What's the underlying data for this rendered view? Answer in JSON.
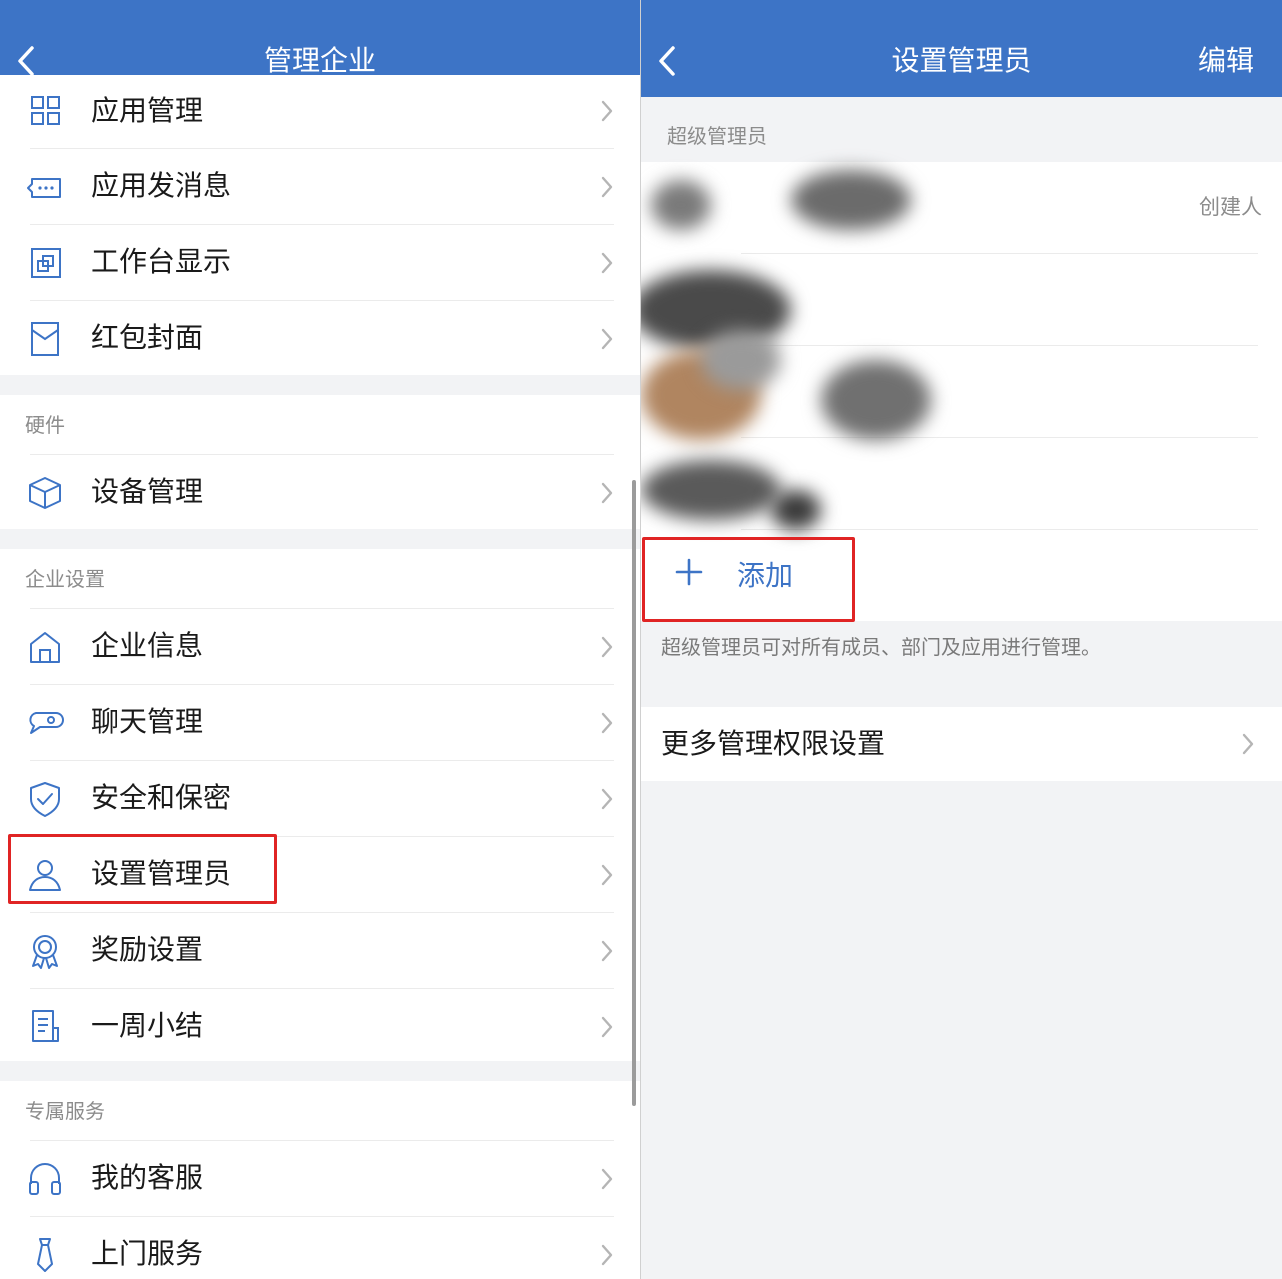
{
  "left": {
    "title": "管理企业",
    "rows_top": [
      {
        "label": "应用管理",
        "icon": "grid-icon"
      },
      {
        "label": "应用发消息",
        "icon": "message-bubble-icon"
      },
      {
        "label": "工作台显示",
        "icon": "workbench-icon"
      },
      {
        "label": "红包封面",
        "icon": "red-envelope-icon"
      }
    ],
    "hardware_header": "硬件",
    "hardware_rows": [
      {
        "label": "设备管理",
        "icon": "cube-icon"
      }
    ],
    "company_header": "企业设置",
    "company_rows": [
      {
        "label": "企业信息",
        "icon": "house-icon"
      },
      {
        "label": "聊天管理",
        "icon": "chat-icon"
      },
      {
        "label": "安全和保密",
        "icon": "shield-icon"
      },
      {
        "label": "设置管理员",
        "icon": "person-icon"
      },
      {
        "label": "奖励设置",
        "icon": "award-icon"
      },
      {
        "label": "一周小结",
        "icon": "document-icon"
      }
    ],
    "service_header": "专属服务",
    "service_rows": [
      {
        "label": "我的客服",
        "icon": "headset-icon"
      },
      {
        "label": "上门服务",
        "icon": "tie-icon"
      }
    ]
  },
  "right": {
    "title": "设置管理员",
    "edit_label": "编辑",
    "section_label": "超级管理员",
    "creator_tag": "创建人",
    "add_label": "添加",
    "note": "超级管理员可对所有成员、部门及应用进行管理。",
    "more_label": "更多管理权限设置"
  },
  "colors": {
    "nav_bg": "#3d74c6",
    "accent": "#3d74c6",
    "highlight": "#e02424",
    "page_bg": "#f2f3f5"
  }
}
